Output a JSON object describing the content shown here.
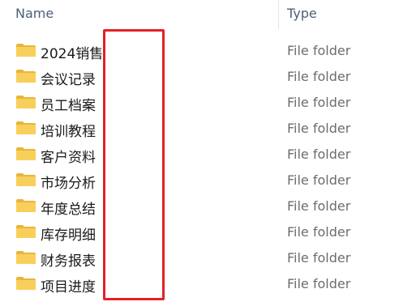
{
  "columns": {
    "name": "Name",
    "type": "Type"
  },
  "rows": [
    {
      "name": "2024销售",
      "type": "File folder"
    },
    {
      "name": "会议记录",
      "type": "File folder"
    },
    {
      "name": "员工档案",
      "type": "File folder"
    },
    {
      "name": "培训教程",
      "type": "File folder"
    },
    {
      "name": "客户资料",
      "type": "File folder"
    },
    {
      "name": "市场分析",
      "type": "File folder"
    },
    {
      "name": "年度总结",
      "type": "File folder"
    },
    {
      "name": "库存明细",
      "type": "File folder"
    },
    {
      "name": "财务报表",
      "type": "File folder"
    },
    {
      "name": "项目进度",
      "type": "File folder"
    }
  ],
  "icons": {
    "folder": "folder-icon"
  },
  "colors": {
    "folder_body": "#f8cf5a",
    "folder_tab": "#e9b53a",
    "redaction_border": "#e5202a"
  }
}
